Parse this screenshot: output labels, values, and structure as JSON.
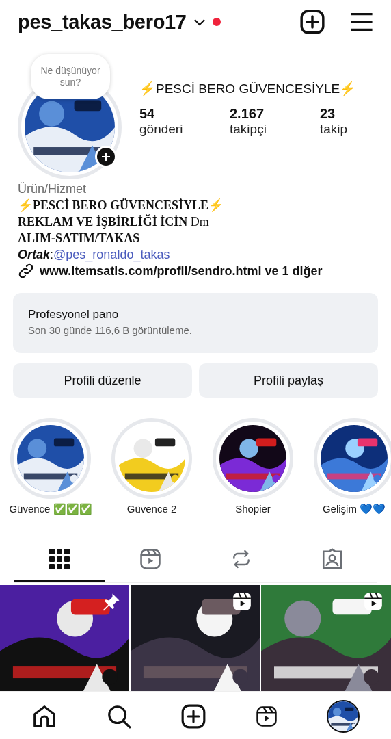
{
  "header": {
    "username": "pes_takas_bero17",
    "has_notification": true
  },
  "profile": {
    "note": "Ne düşünüyor sun?",
    "display_name": "⚡PESCİ BERO GÜVENCESİYLE⚡",
    "stats": [
      {
        "value": "54",
        "label": "gönderi"
      },
      {
        "value": "2.167",
        "label": "takipçi"
      },
      {
        "value": "23",
        "label": "takip"
      }
    ]
  },
  "bio": {
    "category": "Ürün/Hizmet",
    "lines": [
      "⚡**PESCİ BERO GÜVENCESİYLE**⚡",
      "**REKLAM VE İŞBİRLİĞİ İCİN** Dm",
      "**ALIM-SATIM/TAKAS**"
    ],
    "partner_label": "*Ortak*:",
    "partner_mention": "@pes_ronaldo_takas",
    "link": "www.itemsatis.com/profil/sendro.html ve 1 diğer"
  },
  "dashboard": {
    "title": "Profesyonel pano",
    "subtitle": "Son 30 günde 116,6 B görüntüleme."
  },
  "buttons": [
    "Profili düzenle",
    "Profili paylaş"
  ],
  "highlights": [
    {
      "label": "Güvence ✅✅✅",
      "kind": "picture"
    },
    {
      "label": "Güvence 2",
      "kind": "picture"
    },
    {
      "label": "Shopier",
      "kind": "picture"
    },
    {
      "label": "Gelişim 💙💙",
      "kind": "picture"
    }
  ],
  "tabs": [
    {
      "kind": "grid",
      "selected": true
    },
    {
      "kind": "reels",
      "selected": false
    },
    {
      "kind": "reposts",
      "selected": false
    },
    {
      "kind": "tagged",
      "selected": false
    }
  ],
  "posts": [
    {
      "kind": "pinned"
    },
    {
      "kind": "reel"
    },
    {
      "kind": "reel"
    }
  ],
  "nav": [
    {
      "kind": "home"
    },
    {
      "kind": "search"
    },
    {
      "kind": "create"
    },
    {
      "kind": "reels"
    },
    {
      "kind": "profile"
    }
  ]
}
